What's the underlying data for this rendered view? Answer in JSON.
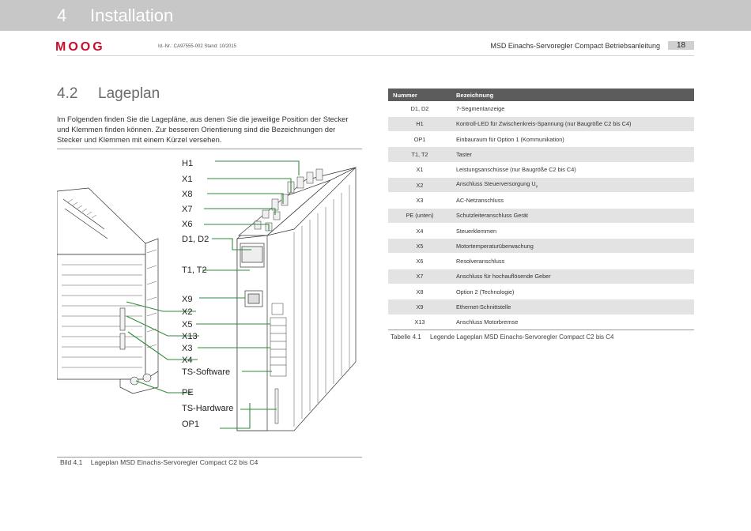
{
  "header": {
    "chapter_number": "4",
    "chapter_title": "Installation",
    "logo_text": "MOOG",
    "id_line": "Id.-Nr.: CA97555-002   Stand: 10/2015",
    "doc_title": "MSD Einachs-Servoregler Compact Betriebsanleitung",
    "page_number": "18"
  },
  "section": {
    "number": "4.2",
    "title": "Lageplan",
    "paragraph": "Im Folgenden finden Sie die Lagepläne, aus denen Sie die jeweilige Position der Stecker und Klemmen finden können. Zur besseren Orientierung sind die Bezeichnungen der Stecker und Klemmen mit einem Kürzel versehen."
  },
  "figure": {
    "callouts": [
      "H1",
      "X1",
      "X8",
      "X7",
      "X6",
      "D1, D2",
      "T1, T2",
      "X9",
      "X2",
      "X5",
      "X13",
      "X3",
      "X4",
      "TS-Software",
      "PE",
      "TS-Hardware",
      "OP1"
    ],
    "caption_label": "Bild 4.1",
    "caption_text": "Lageplan MSD Einachs-Servoregler Compact C2 bis C4",
    "callout_color": "#2e8b3a"
  },
  "table": {
    "headers": [
      "Nummer",
      "Bezeichnung"
    ],
    "rows": [
      {
        "num": "D1, D2",
        "desc": "7-Segmentanzeige"
      },
      {
        "num": "H1",
        "desc": "Kontroll-LED für Zwischenkreis-Spannung (nur Baugröße C2 bis C4)"
      },
      {
        "num": "OP1",
        "desc": "Einbauraum für Option 1 (Kommunikation)"
      },
      {
        "num": "T1, T2",
        "desc": "Taster"
      },
      {
        "num": "X1",
        "desc": "Leistungsanschüsse (nur Baugröße C2 bis C4)"
      },
      {
        "num": "X2",
        "desc": "Anschluss Steuerversorgung U",
        "sub": "v"
      },
      {
        "num": "X3",
        "desc": "AC-Netzanschluss"
      },
      {
        "num": "PE (unten)",
        "desc": "Schutzleiteranschluss Gerät"
      },
      {
        "num": "X4",
        "desc": "Steuerklemmen"
      },
      {
        "num": "X5",
        "desc": "Motortemperaturüberwachung"
      },
      {
        "num": "X6",
        "desc": "Resolveranschluss"
      },
      {
        "num": "X7",
        "desc": "Anschluss für hochauflösende Geber"
      },
      {
        "num": "X8",
        "desc": "Option 2 (Technologie)"
      },
      {
        "num": "X9",
        "desc": "Ethernet-Schnittstelle"
      },
      {
        "num": "X13",
        "desc": "Anschluss Motorbremse"
      }
    ],
    "caption_label": "Tabelle 4.1",
    "caption_text": "Legende Lageplan MSD Einachs-Servoregler Compact C2 bis C4"
  },
  "colors": {
    "header_band": "#c7c7c7",
    "logo_red": "#c8102e",
    "table_header": "#5c5c5c",
    "table_alt_row": "#e3e3e3"
  }
}
